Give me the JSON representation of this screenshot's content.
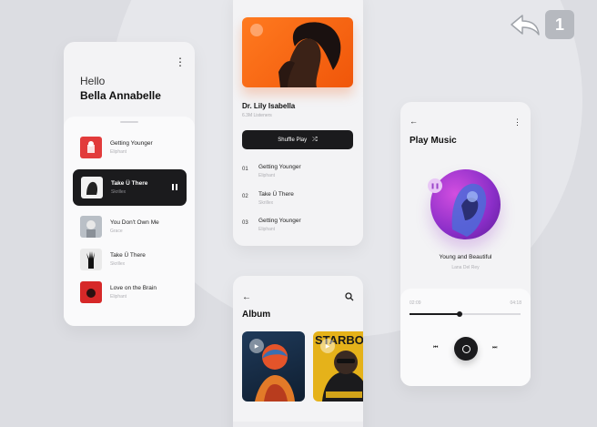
{
  "playlist": {
    "greeting": "Hello",
    "user_name": "Bella Annabelle",
    "songs": [
      {
        "title": "Getting Younger",
        "artist": "Eliphant"
      },
      {
        "title": "Take Ü There",
        "artist": "Skrillex"
      },
      {
        "title": "You Don't Own Me",
        "artist": "Grace"
      },
      {
        "title": "Take Ü There",
        "artist": "Skrillex"
      },
      {
        "title": "Love on the Brain",
        "artist": "Eliphant"
      }
    ]
  },
  "artist": {
    "name": "Dr. Lily Isabella",
    "listeners": "6.3M Listeners",
    "shuffle_label": "Shuffle Play",
    "tracks": [
      {
        "num": "01",
        "title": "Getting Younger",
        "artist": "Eliphant"
      },
      {
        "num": "02",
        "title": "Take Ü There",
        "artist": "Skrillex"
      },
      {
        "num": "03",
        "title": "Getting Younger",
        "artist": "Eliphant"
      }
    ]
  },
  "album": {
    "title": "Album",
    "tiles": [
      {
        "caption": ""
      },
      {
        "caption": "STARBOY"
      }
    ]
  },
  "player": {
    "title": "Play Music",
    "song": "Young and Beautiful",
    "artist": "Lana Del Rey",
    "time_current": "02:09",
    "time_total": "04:18",
    "progress": 0.45
  },
  "corner": {
    "step": "1"
  }
}
